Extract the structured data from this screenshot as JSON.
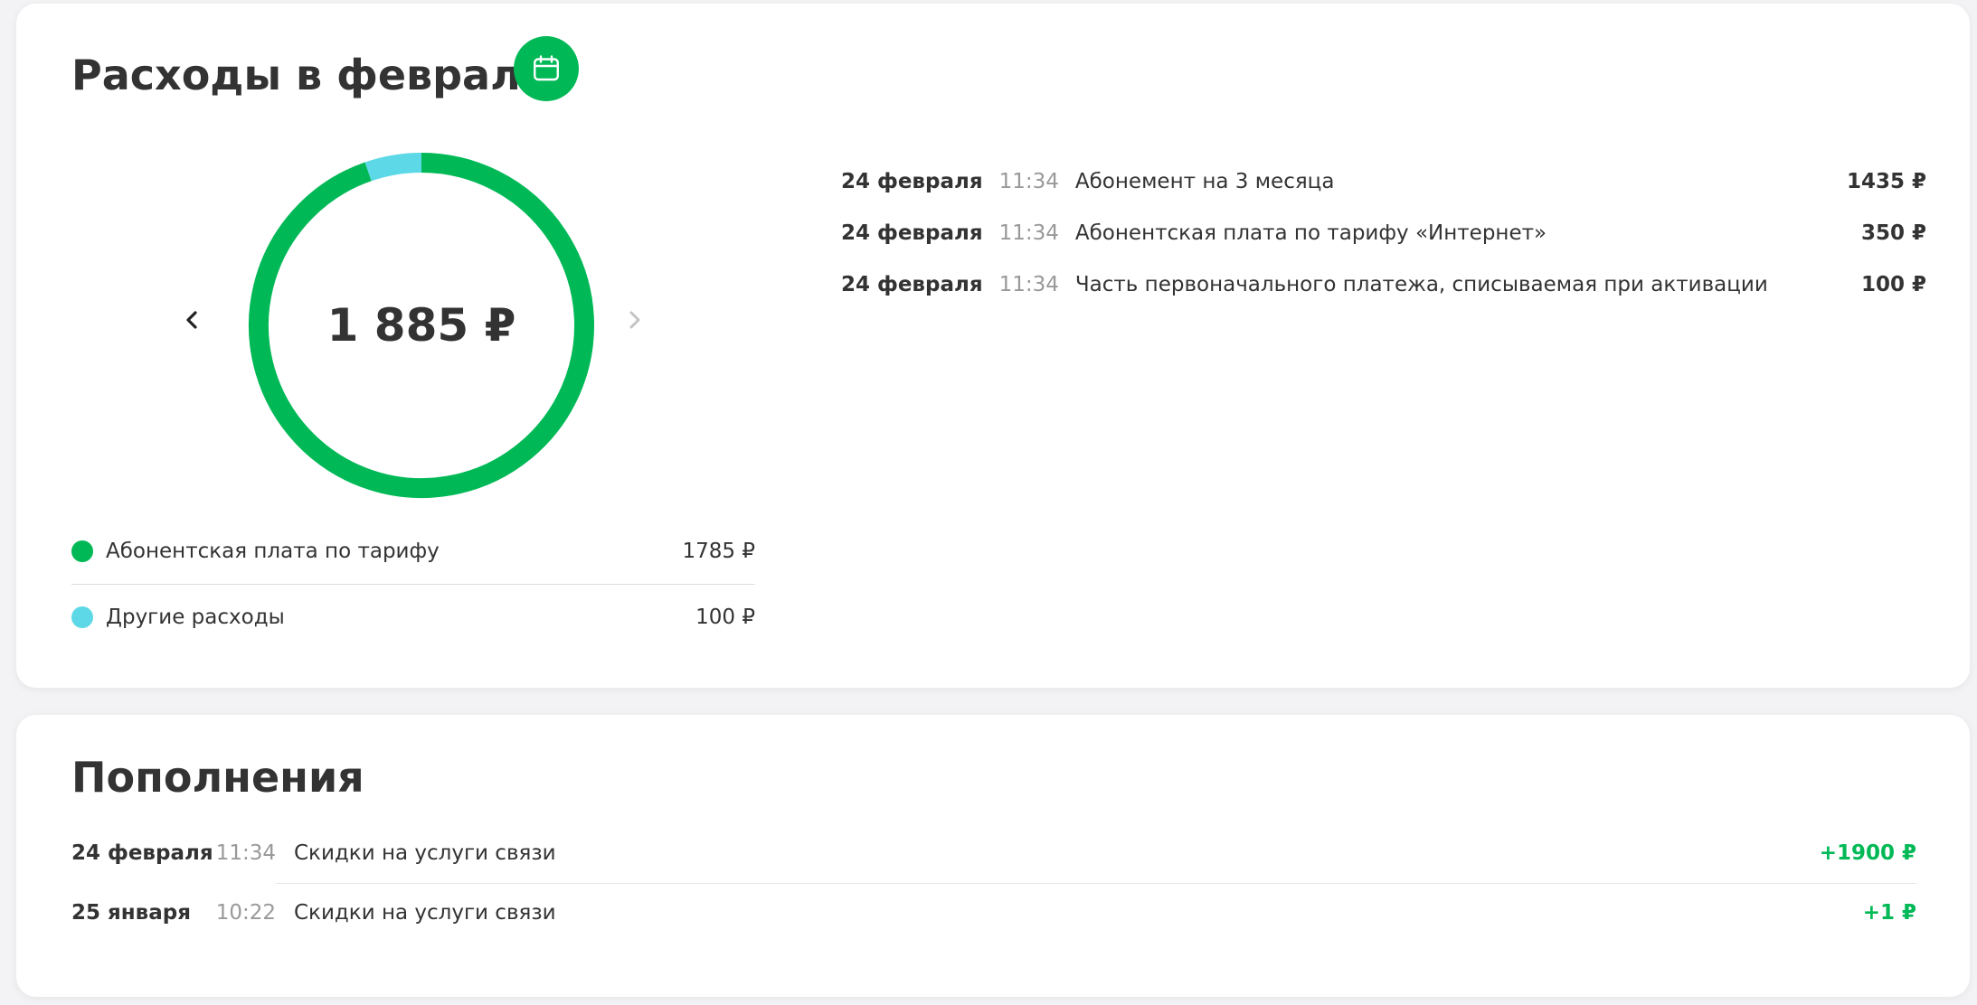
{
  "expenses": {
    "title": "Расходы в феврале",
    "total": "1 885 ₽",
    "chart_data": {
      "type": "pie",
      "categories": [
        "Абонентская плата по тарифу",
        "Другие расходы"
      ],
      "values": [
        1785,
        100
      ],
      "colors": [
        "#00b956",
        "#5cd8e6"
      ]
    },
    "legend": [
      {
        "label": "Абонентская плата по тарифу",
        "value": "1785 ₽",
        "color": "#00b956"
      },
      {
        "label": "Другие расходы",
        "value": "100 ₽",
        "color": "#5cd8e6"
      }
    ],
    "transactions": [
      {
        "date": "24 февраля",
        "time": "11:34",
        "description": "Абонемент на 3 месяца",
        "amount": "1435 ₽"
      },
      {
        "date": "24 февраля",
        "time": "11:34",
        "description": "Абонентская плата по тарифу «Интернет»",
        "amount": "350 ₽"
      },
      {
        "date": "24 февраля",
        "time": "11:34",
        "description": "Часть первоначального платежа, списываемая при активации",
        "amount": "100 ₽"
      }
    ]
  },
  "topups": {
    "title": "Пополнения",
    "items": [
      {
        "date": "24 февраля",
        "time": "11:34",
        "description": "Скидки на услуги связи",
        "amount": "+1900 ₽"
      },
      {
        "date": "25 января",
        "time": "10:22",
        "description": "Скидки на услуги связи",
        "amount": "+1 ₽"
      }
    ]
  },
  "icons": {
    "calendar": "calendar-icon",
    "prev": "chevron-left-icon",
    "next": "chevron-right-icon"
  },
  "colors": {
    "accent": "#00b956",
    "secondary": "#5cd8e6",
    "text": "#333333",
    "muted": "#999999"
  }
}
